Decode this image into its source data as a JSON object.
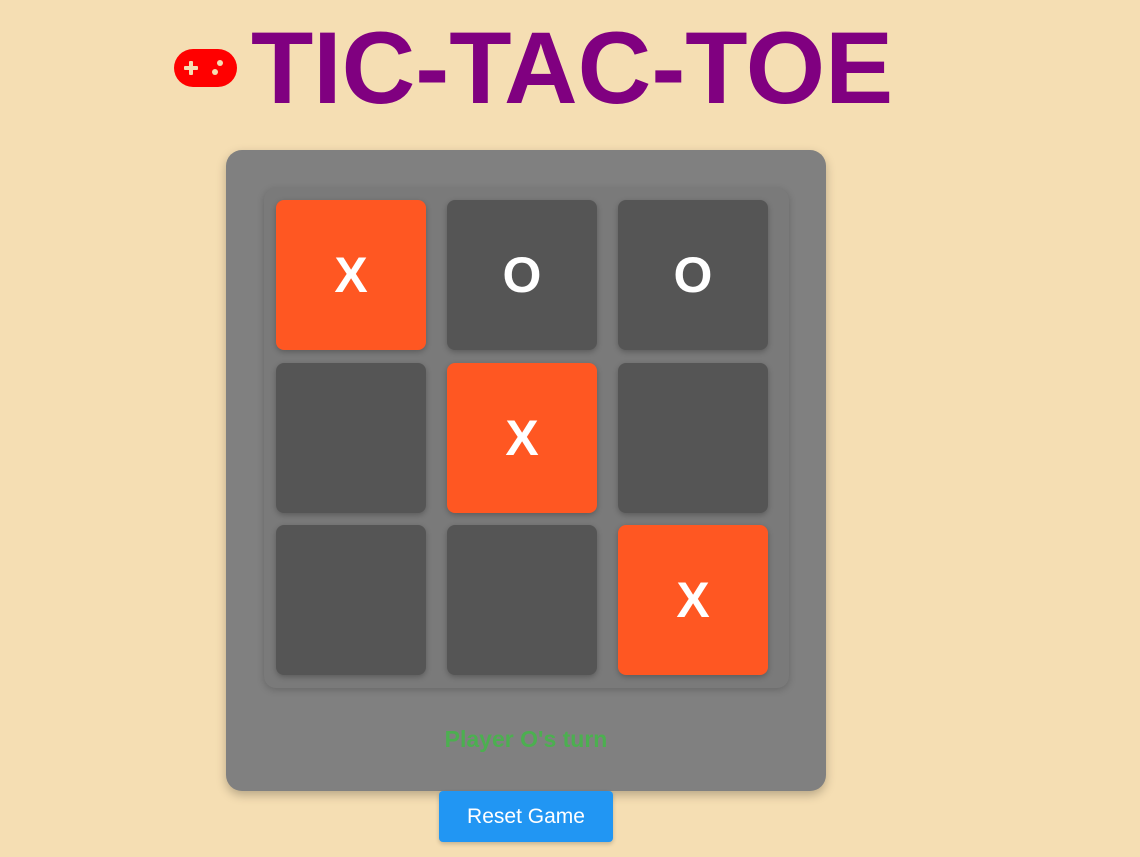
{
  "header": {
    "title": "TIC-TAC-TOE",
    "icon": "gamepad-icon"
  },
  "board": {
    "cells": [
      {
        "value": "X"
      },
      {
        "value": "O"
      },
      {
        "value": "O"
      },
      {
        "value": ""
      },
      {
        "value": "X"
      },
      {
        "value": ""
      },
      {
        "value": ""
      },
      {
        "value": ""
      },
      {
        "value": "X"
      }
    ]
  },
  "status": {
    "text": "Player O's turn"
  },
  "controls": {
    "reset_label": "Reset Game"
  },
  "colors": {
    "background": "#f5deb3",
    "title": "#800080",
    "panel": "#808080",
    "cell_empty": "#555555",
    "cell_x": "#ff5722",
    "status": "#4caf50",
    "button": "#2196f3",
    "icon": "#ff0000"
  }
}
